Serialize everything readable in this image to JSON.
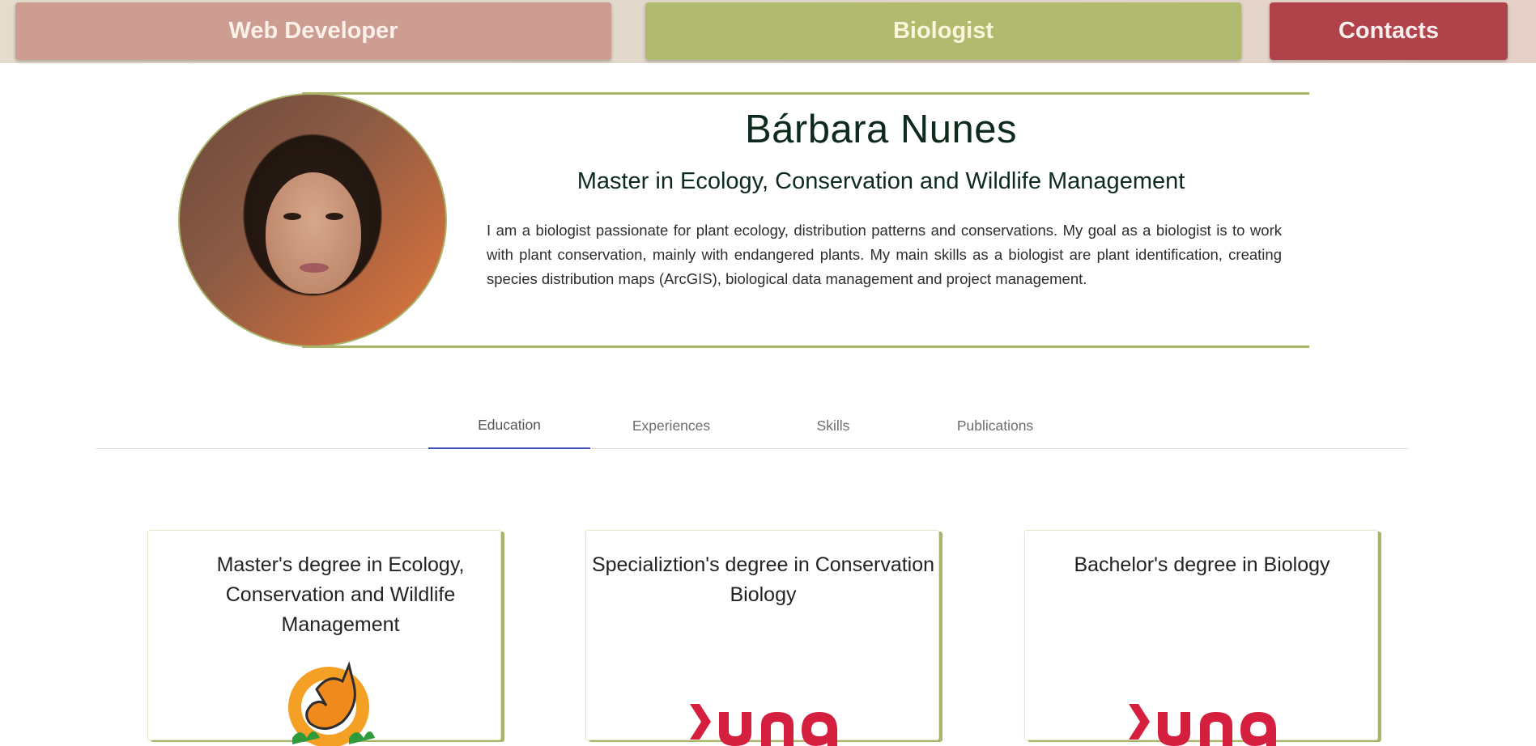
{
  "nav": {
    "web_developer": "Web Developer",
    "biologist": "Biologist",
    "contacts": "Contacts"
  },
  "profile": {
    "name": "Bárbara Nunes",
    "degree": "Master in Ecology, Conservation and Wildlife Management",
    "bio": "I am a biologist passionate for plant ecology, distribution patterns and conservations. My goal as a biologist is to work with plant conservation, mainly with endangered plants. My main skills as a biologist are plant identification, creating species distribution maps (ArcGIS), biological data management and project management."
  },
  "tabs": {
    "education": "Education",
    "experiences": "Experiences",
    "skills": "Skills",
    "publications": "Publications",
    "active": "Education"
  },
  "cards": [
    {
      "title": "Master's degree in Ecology, Conservation and Wildlife Management",
      "logo": "fox-logo"
    },
    {
      "title": "Specializtion's degree in Conservation Biology",
      "logo": "una-logo"
    },
    {
      "title": "Bachelor's degree in Biology",
      "logo": "una-logo"
    }
  ],
  "colors": {
    "nav_web_developer": "#cc9d90",
    "nav_biologist": "#b1bb6f",
    "nav_contacts": "#b0434a",
    "accent_line": "#a9b46a",
    "tab_active": "#3f51b5",
    "una_red": "#d51f3e"
  }
}
